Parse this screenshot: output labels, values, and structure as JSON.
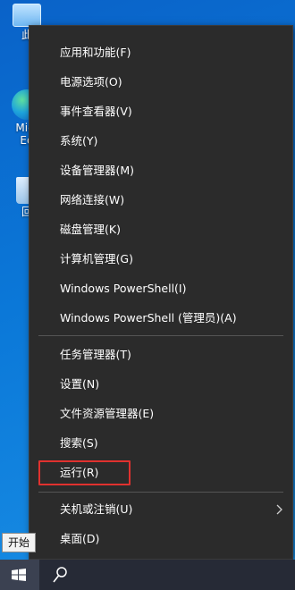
{
  "desktop": {
    "icons": [
      {
        "label": "此",
        "icon": "this-pc-icon"
      },
      {
        "label": "Micr Ed",
        "icon": "edge-icon"
      },
      {
        "label": "回",
        "icon": "recycle-bin-icon"
      }
    ]
  },
  "context_menu": {
    "group1": [
      {
        "label": "应用和功能(F)"
      },
      {
        "label": "电源选项(O)"
      },
      {
        "label": "事件查看器(V)"
      },
      {
        "label": "系统(Y)"
      },
      {
        "label": "设备管理器(M)"
      },
      {
        "label": "网络连接(W)"
      },
      {
        "label": "磁盘管理(K)"
      },
      {
        "label": "计算机管理(G)"
      },
      {
        "label": "Windows PowerShell(I)"
      },
      {
        "label": "Windows PowerShell (管理员)(A)"
      }
    ],
    "group2": [
      {
        "label": "任务管理器(T)"
      },
      {
        "label": "设置(N)"
      },
      {
        "label": "文件资源管理器(E)"
      },
      {
        "label": "搜索(S)"
      },
      {
        "label": "运行(R)",
        "highlighted": true
      }
    ],
    "group3": [
      {
        "label": "关机或注销(U)",
        "submenu_icon": "chevron-right-icon"
      },
      {
        "label": "桌面(D)"
      }
    ],
    "highlight_color": "#e0312f"
  },
  "taskbar": {
    "start_tooltip": "开始",
    "start_icon": "windows-logo-icon",
    "search_icon": "search-icon"
  }
}
